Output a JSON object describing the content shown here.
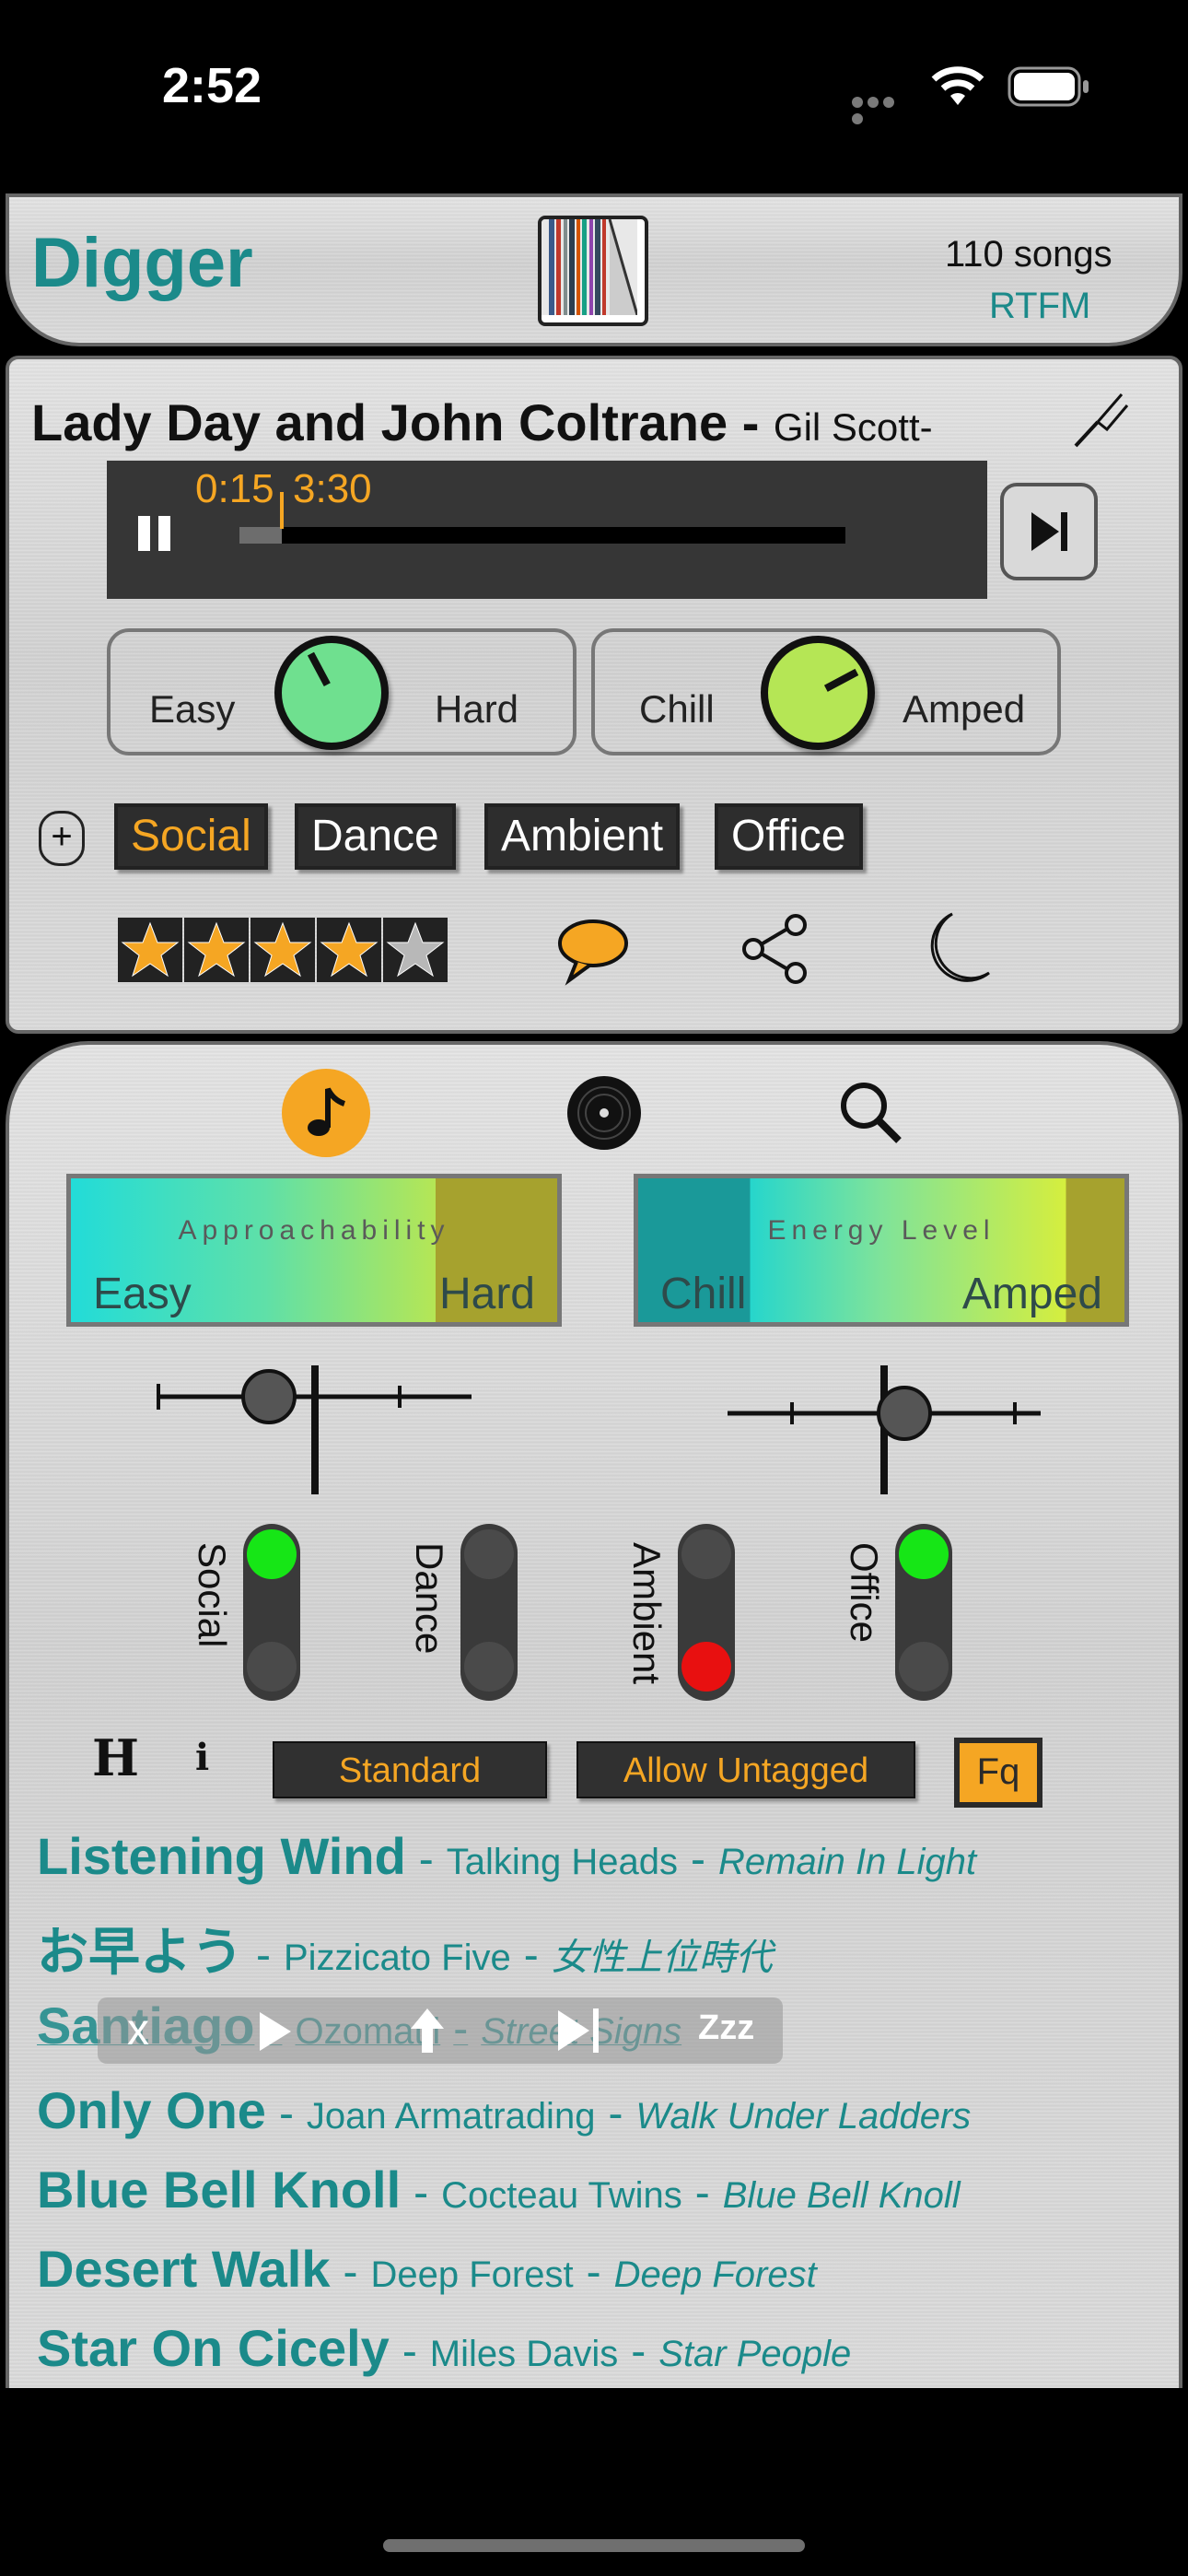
{
  "status_bar": {
    "time": "2:52"
  },
  "header": {
    "title": "Digger",
    "song_count": "110 songs",
    "station": "RTFM"
  },
  "now_playing": {
    "title": "Lady Day and John Coltrane",
    "separator": "-",
    "artist": "Gil Scott-",
    "elapsed": "0:15",
    "duration": "3:30",
    "progress": 0.07
  },
  "knobs": [
    {
      "left_label": "Easy",
      "right_label": "Hard",
      "color": "#6fe08f"
    },
    {
      "left_label": "Chill",
      "right_label": "Amped",
      "color": "#b5e655"
    }
  ],
  "tags": [
    {
      "label": "Social",
      "active": true
    },
    {
      "label": "Dance",
      "active": false
    },
    {
      "label": "Ambient",
      "active": false
    },
    {
      "label": "Office",
      "active": false
    }
  ],
  "rating": {
    "value": 4,
    "max": 5
  },
  "actions": [
    "comment-icon",
    "share-icon",
    "sleep-moon-icon"
  ],
  "browser": {
    "modes": [
      "music-note-icon",
      "vinyl-record-icon",
      "search-icon"
    ],
    "gauges": [
      {
        "title": "Approachability",
        "left": "Easy",
        "right": "Hard"
      },
      {
        "title": "Energy Level",
        "left": "Chill",
        "right": "Amped"
      }
    ],
    "switches": [
      {
        "label": "Social",
        "state": "on"
      },
      {
        "label": "Dance",
        "state": "off"
      },
      {
        "label": "Ambient",
        "state": "excluded"
      },
      {
        "label": "Office",
        "state": "on"
      }
    ],
    "buttons": {
      "h": "H",
      "i": "i",
      "standard": "Standard",
      "untagged": "Allow Untagged",
      "fq": "Fq"
    },
    "songs": [
      {
        "title": "Listening Wind",
        "artist": "Talking Heads",
        "album": "Remain In Light"
      },
      {
        "title": "お早よう",
        "artist": "Pizzicato Five",
        "album": "女性上位時代"
      },
      {
        "title": "Santiago",
        "artist": "Ozomatli",
        "album": "Street Signs"
      },
      {
        "title": "Only One",
        "artist": "Joan Armatrading",
        "album": "Walk Under Ladders"
      },
      {
        "title": "Blue Bell Knoll",
        "artist": "Cocteau Twins",
        "album": "Blue Bell Knoll"
      },
      {
        "title": "Desert Walk",
        "artist": "Deep Forest",
        "album": "Deep Forest"
      },
      {
        "title": "Star On Cicely",
        "artist": "Miles Davis",
        "album": "Star People"
      }
    ],
    "swipe_actions": [
      "x",
      "play-icon",
      "upload-icon",
      "skip-next-icon",
      "Zzz"
    ],
    "separator": "-"
  },
  "colors": {
    "accent": "#1b8a8a",
    "orange": "#f5a623"
  }
}
